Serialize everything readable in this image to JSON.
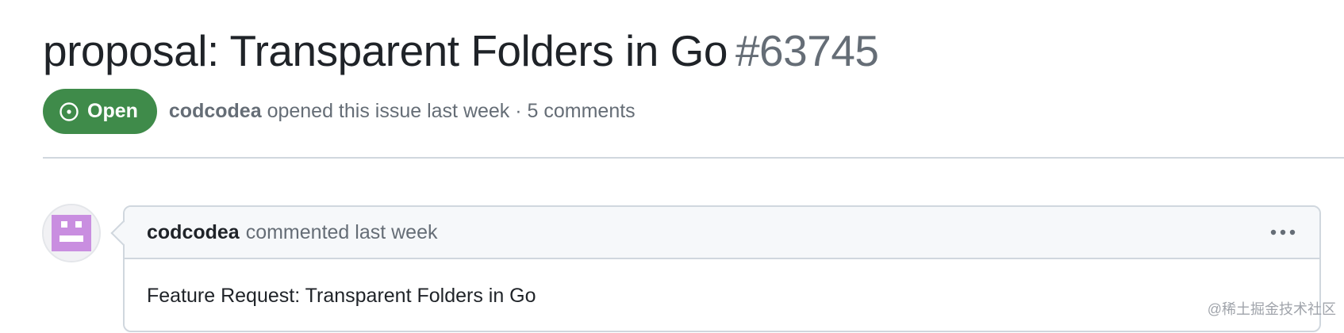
{
  "issue": {
    "title": "proposal: Transparent Folders in Go",
    "number": "#63745",
    "state": "Open",
    "state_color": "#3f8b4a",
    "author": "codcodea",
    "meta_suffix": "opened this issue last week · 5 comments"
  },
  "comment": {
    "author": "codcodea",
    "action": "commented last week",
    "body": "Feature Request: Transparent Folders in Go",
    "menu_icon": "kebab-horizontal-icon",
    "avatar_color": "#c98ee0"
  },
  "watermark": "@稀土掘金技术社区"
}
